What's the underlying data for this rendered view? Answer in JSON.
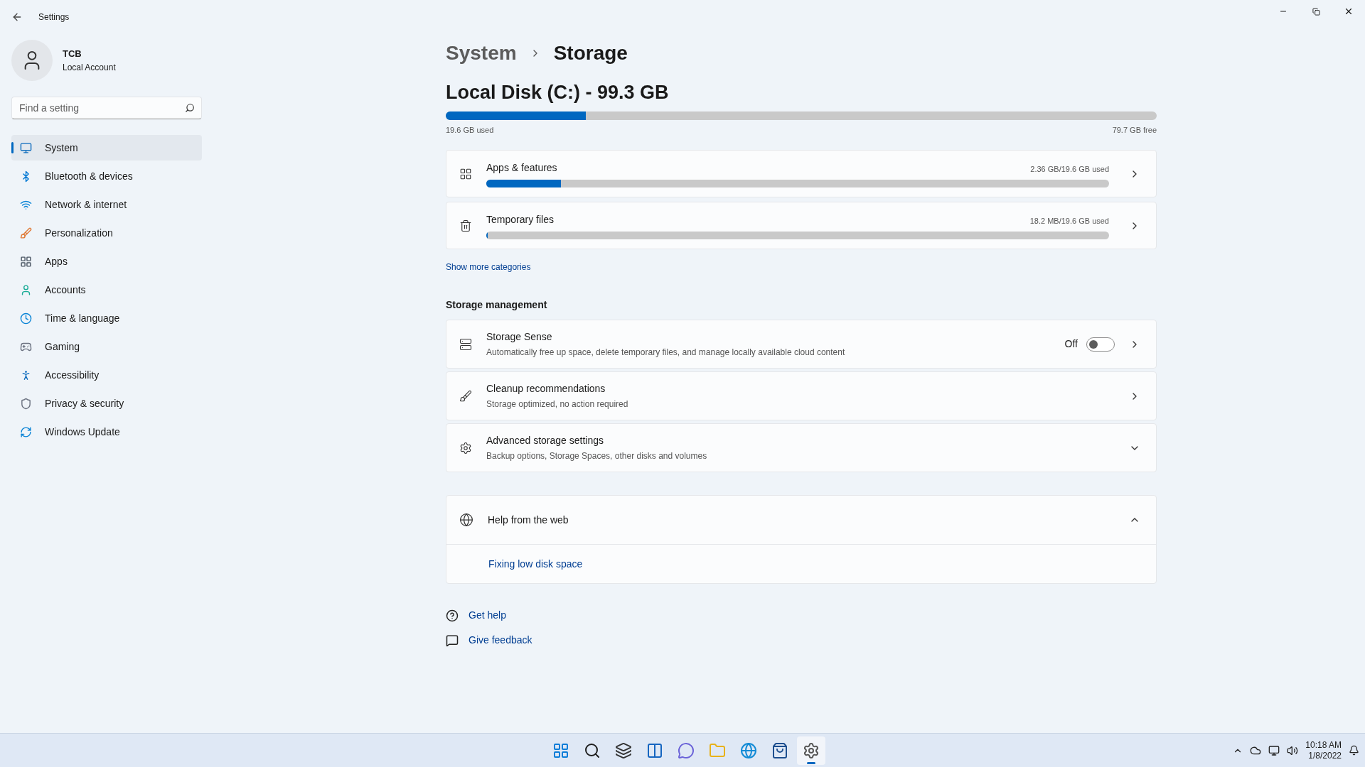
{
  "window": {
    "title": "Settings"
  },
  "account": {
    "name": "TCB",
    "type": "Local Account"
  },
  "search": {
    "placeholder": "Find a setting"
  },
  "sidebar": {
    "items": [
      {
        "label": "System",
        "selected": true
      },
      {
        "label": "Bluetooth & devices",
        "selected": false
      },
      {
        "label": "Network & internet",
        "selected": false
      },
      {
        "label": "Personalization",
        "selected": false
      },
      {
        "label": "Apps",
        "selected": false
      },
      {
        "label": "Accounts",
        "selected": false
      },
      {
        "label": "Time & language",
        "selected": false
      },
      {
        "label": "Gaming",
        "selected": false
      },
      {
        "label": "Accessibility",
        "selected": false
      },
      {
        "label": "Privacy & security",
        "selected": false
      },
      {
        "label": "Windows Update",
        "selected": false
      }
    ]
  },
  "breadcrumb": [
    "System",
    "Storage"
  ],
  "disk": {
    "title": "Local Disk (C:) - 99.3 GB",
    "level": 0.197,
    "used": "19.6 GB used",
    "free": "79.7 GB free"
  },
  "categories": [
    {
      "title": "Apps & features",
      "usage": "2.36 GB/19.6 GB used",
      "level": 0.12
    },
    {
      "title": "Temporary files",
      "usage": "18.2 MB/19.6 GB used",
      "level": 0.002
    }
  ],
  "show_more": "Show more categories",
  "storage_management": {
    "heading": "Storage management",
    "items": [
      {
        "kind": "toggle",
        "title": "Storage Sense",
        "subtitle": "Automatically free up space, delete temporary files, and manage locally available cloud content",
        "state_label": "Off",
        "on": false
      },
      {
        "kind": "link",
        "title": "Cleanup recommendations",
        "subtitle": "Storage optimized, no action required"
      },
      {
        "kind": "expander",
        "title": "Advanced storage settings",
        "subtitle": "Backup options, Storage Spaces, other disks and volumes",
        "expanded": false
      }
    ]
  },
  "help": {
    "title": "Help from the web",
    "expanded": true,
    "links": [
      "Fixing low disk space"
    ]
  },
  "footer_links": [
    "Get help",
    "Give feedback"
  ],
  "taskbar": {
    "apps": [
      {
        "selected": false
      },
      {
        "selected": false
      },
      {
        "selected": false
      },
      {
        "selected": false
      },
      {
        "selected": false
      },
      {
        "selected": false
      },
      {
        "selected": false
      },
      {
        "selected": false
      },
      {
        "selected": true
      }
    ],
    "time": "10:18 AM",
    "date": "1/8/2022"
  }
}
